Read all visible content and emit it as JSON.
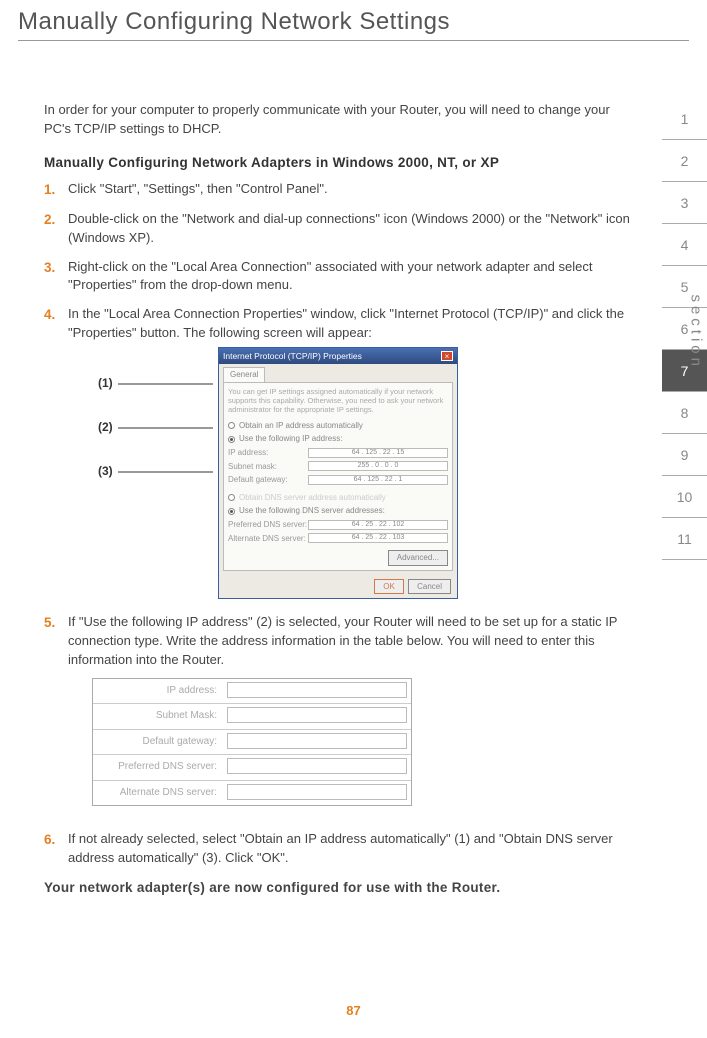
{
  "title": "Manually Configuring Network Settings",
  "intro": "In order for your computer to properly communicate with your Router, you will need to change your PC's TCP/IP settings to DHCP.",
  "subheading": "Manually Configuring Network Adapters in Windows 2000, NT, or XP",
  "steps": {
    "s1": {
      "num": "1.",
      "text": "Click \"Start\", \"Settings\", then \"Control Panel\"."
    },
    "s2": {
      "num": "2.",
      "text": "Double-click on the \"Network and dial-up connections\" icon (Windows 2000) or the \"Network\" icon (Windows XP)."
    },
    "s3": {
      "num": "3.",
      "text": "Right-click on the \"Local Area Connection\" associated with your network adapter and select \"Properties\" from the drop-down menu."
    },
    "s4": {
      "num": "4.",
      "text": "In the \"Local Area Connection Properties\" window, click \"Internet Protocol (TCP/IP)\" and click the \"Properties\" button. The following screen will appear:"
    },
    "s5": {
      "num": "5.",
      "text": "If \"Use the following IP address\" (2) is selected, your Router will need to be set up for a static IP connection type. Write the address information in the table below. You will need to enter this information into the Router."
    },
    "s6": {
      "num": "6.",
      "text": "If not already selected, select \"Obtain an IP address automatically\" (1) and \"Obtain DNS server address automatically\" (3). Click \"OK\"."
    }
  },
  "callouts": {
    "c1": "(1)",
    "c2": "(2)",
    "c3": "(3)"
  },
  "dialog": {
    "title": "Internet Protocol (TCP/IP) Properties",
    "tab": "General",
    "desc": "You can get IP settings assigned automatically if your network supports this capability. Otherwise, you need to ask your network administrator for the appropriate IP settings.",
    "radio_auto_ip": "Obtain an IP address automatically",
    "radio_use_ip": "Use the following IP address:",
    "ip_label": "IP address:",
    "ip_value": "64 . 125 . 22 . 15",
    "subnet_label": "Subnet mask:",
    "subnet_value": "255 . 0 . 0 . 0",
    "gateway_label": "Default gateway:",
    "gateway_value": "64 . 125 . 22 . 1",
    "radio_auto_dns": "Obtain DNS server address automatically",
    "radio_use_dns": "Use the following DNS server addresses:",
    "pref_dns_label": "Preferred DNS server:",
    "pref_dns_value": "64 . 25 . 22 . 102",
    "alt_dns_label": "Alternate DNS server:",
    "alt_dns_value": "64 . 25 . 22 . 103",
    "advanced": "Advanced...",
    "ok": "OK",
    "cancel": "Cancel"
  },
  "info_table": {
    "ip": "IP address:",
    "subnet": "Subnet Mask:",
    "gateway": "Default gateway:",
    "pref_dns": "Preferred DNS server:",
    "alt_dns": "Alternate DNS server:"
  },
  "closing": "Your network adapter(s) are now configured for use with the Router.",
  "section_tabs": [
    "1",
    "2",
    "3",
    "4",
    "5",
    "6",
    "7",
    "8",
    "9",
    "10",
    "11"
  ],
  "current_section": "7",
  "section_label": "section",
  "page_number": "87"
}
